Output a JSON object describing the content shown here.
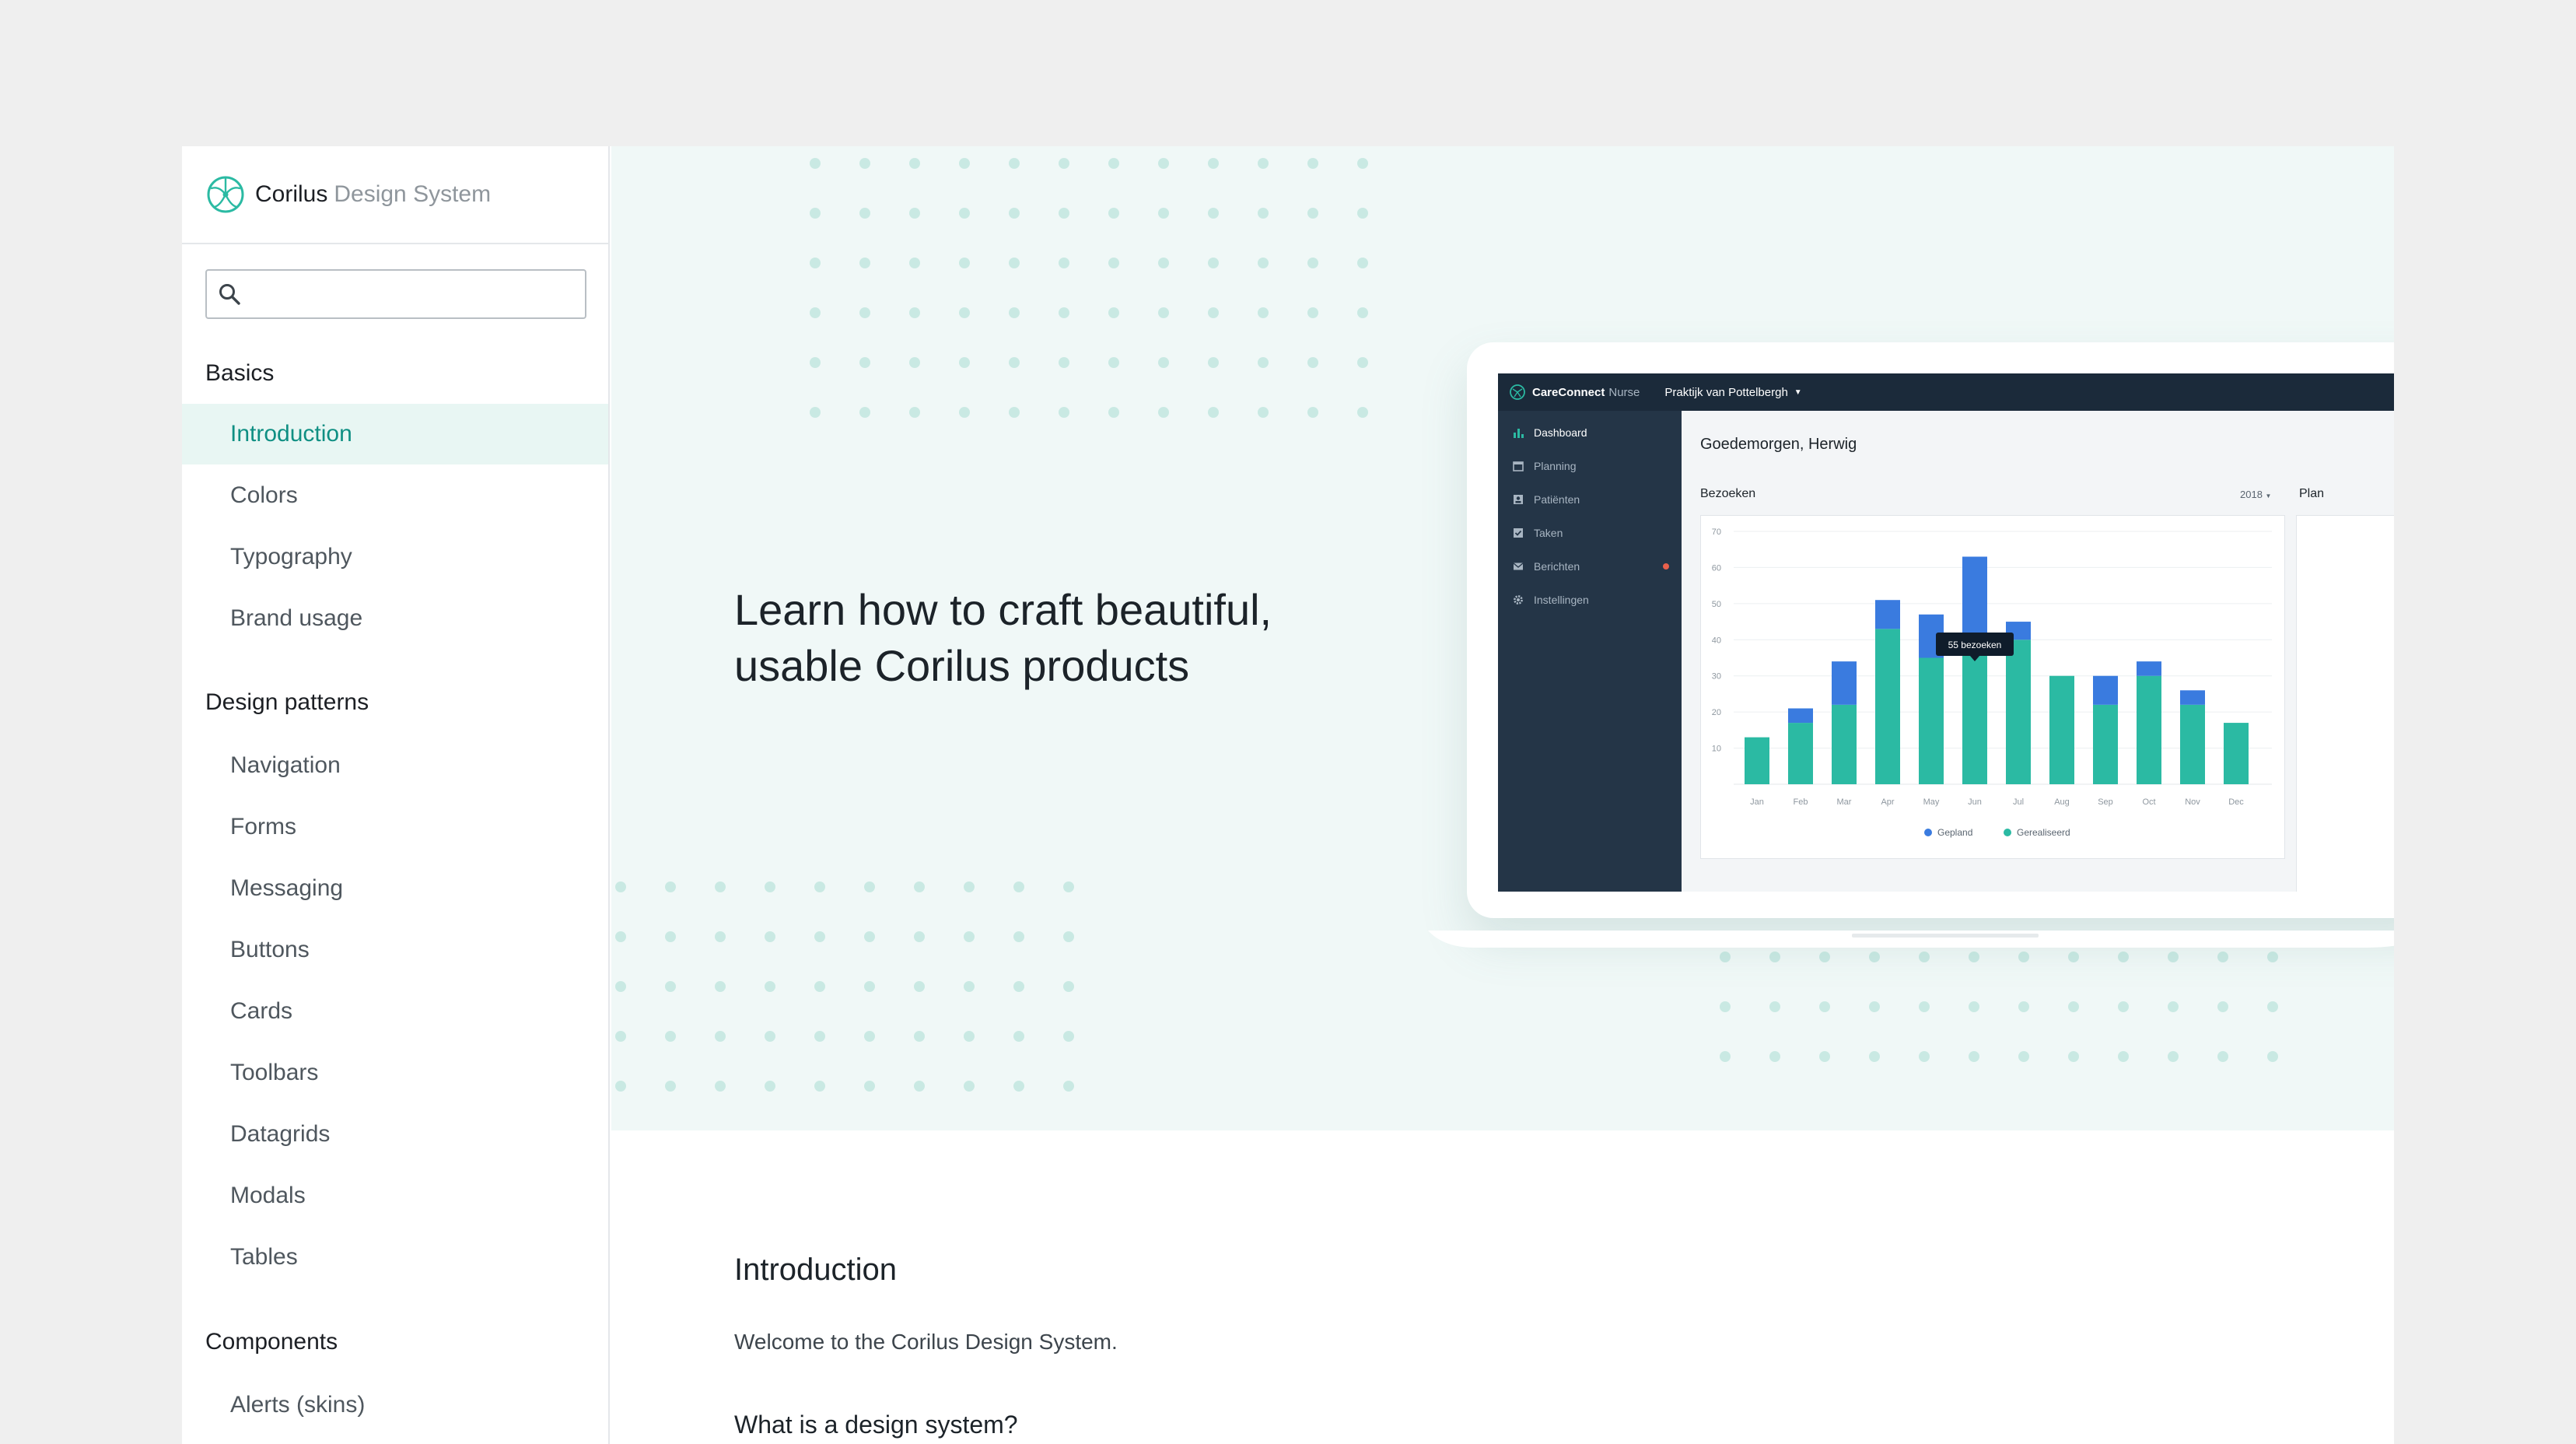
{
  "brand": {
    "name": "Corilus",
    "subtitle": "Design System"
  },
  "search": {
    "placeholder": "",
    "value": ""
  },
  "sidebar": {
    "groups": [
      {
        "title": "Basics",
        "items": [
          "Introduction",
          "Colors",
          "Typography",
          "Brand usage"
        ]
      },
      {
        "title": "Design patterns",
        "items": [
          "Navigation",
          "Forms",
          "Messaging",
          "Buttons",
          "Cards",
          "Toolbars",
          "Datagrids",
          "Modals",
          "Tables"
        ]
      },
      {
        "title": "Components",
        "items": [
          "Alerts (skins)"
        ]
      }
    ],
    "active_item": "Introduction"
  },
  "hero": {
    "heading": "Learn how to craft beautiful, usable Corilus products"
  },
  "mockup": {
    "app_name": "CareConnect",
    "app_edition": "Nurse",
    "practice": "Praktijk van Pottelbergh",
    "nav": [
      "Dashboard",
      "Planning",
      "Patiënten",
      "Taken",
      "Berichten",
      "Instellingen"
    ],
    "active_nav": "Dashboard",
    "greeting": "Goedemorgen, Herwig",
    "visits_label": "Bezoeken",
    "year": "2018",
    "plan_label": "Plan",
    "tooltip": "55 bezoeken"
  },
  "content": {
    "title": "Introduction",
    "welcome": "Welcome to the Corilus Design System.",
    "subheading": "What is a design system?"
  },
  "colors": {
    "accent": "#0f8f83",
    "teal": "#2bbaa3",
    "blue": "#3a7bdf",
    "app_dark": "#243547"
  },
  "chart_data": {
    "type": "bar",
    "stacked": true,
    "categories": [
      "Jan",
      "Feb",
      "Mar",
      "Apr",
      "May",
      "Jun",
      "Jul",
      "Aug",
      "Sep",
      "Oct",
      "Nov",
      "Dec"
    ],
    "series": [
      {
        "name": "Gerealiseerd",
        "values": [
          13,
          17,
          22,
          43,
          35,
          40,
          40,
          30,
          22,
          30,
          22,
          17
        ]
      },
      {
        "name": "Gepland",
        "values": [
          0,
          4,
          12,
          8,
          12,
          23,
          5,
          0,
          8,
          4,
          4,
          0
        ]
      }
    ],
    "y_ticks": [
      10,
      20,
      30,
      40,
      50,
      60,
      70
    ],
    "ylim": [
      0,
      70
    ],
    "legend_position": "bottom",
    "grid": true
  }
}
